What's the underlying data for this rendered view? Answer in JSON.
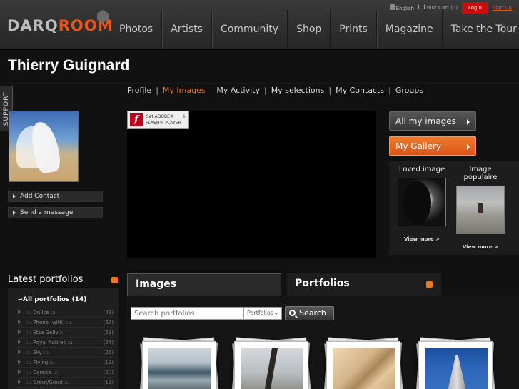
{
  "logo": {
    "part1": "DARQ",
    "part2": "ROOM"
  },
  "nav": [
    "Photos",
    "Artists",
    "Community",
    "Shop",
    "Prints",
    "Magazine",
    "Take the Tour"
  ],
  "util": {
    "language": "English",
    "cart": "Your Cart (0)",
    "login": "Login",
    "signup": "Sign Up"
  },
  "title": "Thierry Guignard",
  "support": "SUPPORT",
  "subnav": {
    "items": [
      "Profile",
      "My Images",
      "My Activity",
      "My selections",
      "My Contacts",
      "Groups"
    ],
    "separator": "|",
    "active_index": 1
  },
  "flash_badge": {
    "line1": "Get ADOBE®",
    "line2": "FLASH® PLAYER",
    "icon": "f"
  },
  "profile_buttons": {
    "add_contact": "Add Contact",
    "send_message": "Send a message"
  },
  "right_buttons": {
    "all_images": "All my images",
    "my_gallery": "My Gallery"
  },
  "features": [
    {
      "label": "Loved image",
      "link": "View more  >"
    },
    {
      "label": "Image populaire",
      "link": "View more  >"
    }
  ],
  "latest_portfolios": {
    "title": "Latest portfolios",
    "all_label": "All portfolios (14)",
    "items": [
      {
        "name": "::: On Ice :::",
        "count": "(49)"
      },
      {
        "name": "::: Phone (with) :::",
        "count": "(67)"
      },
      {
        "name": "::: Etsa Gelly :::",
        "count": "(53)"
      },
      {
        "name": "::: Royal Aubrac :::",
        "count": "(24)"
      },
      {
        "name": "::: Sky :::",
        "count": "(26)"
      },
      {
        "name": "::: Flying :::",
        "count": "(19)"
      },
      {
        "name": "::: Corsica :::",
        "count": "(60)"
      },
      {
        "name": "::: Grout/Grout :::",
        "count": "(19)"
      }
    ]
  },
  "tabs": {
    "images": "Images",
    "portfolios": "Portfolios"
  },
  "search": {
    "placeholder": "Search portfolios",
    "select_value": "Portfolios",
    "button": "Search"
  },
  "colors": {
    "accent": "#e8561a",
    "login": "#cc0b0b",
    "background": "#111111"
  }
}
